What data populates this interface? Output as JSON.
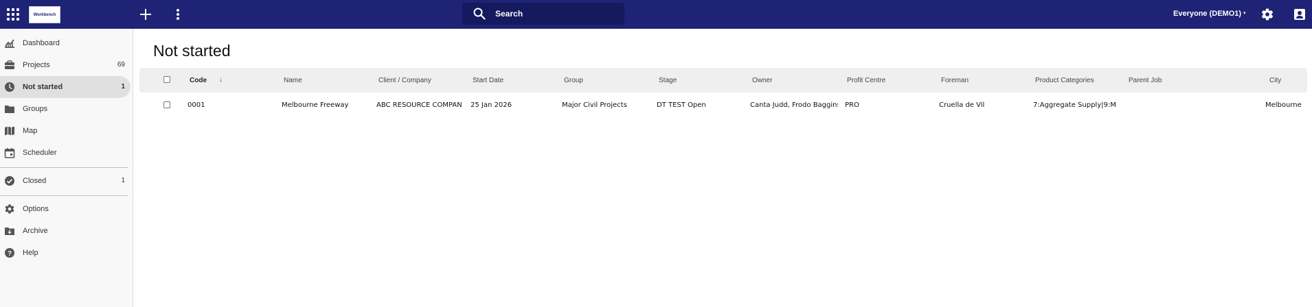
{
  "header": {
    "logo_text": "Workbench",
    "search_label": "Search",
    "workspace_label": "Everyone (DEMO1)",
    "workspace_caret": "▾"
  },
  "sidebar": {
    "items": [
      {
        "label": "Dashboard",
        "count": "",
        "icon": "dashboard-chart-icon"
      },
      {
        "label": "Projects",
        "count": "69",
        "icon": "projects-folder-icon"
      },
      {
        "label": "Not started",
        "count": "1",
        "icon": "clock-icon",
        "active": true
      },
      {
        "label": "Groups",
        "count": "",
        "icon": "folder-icon"
      },
      {
        "label": "Map",
        "count": "",
        "icon": "map-icon"
      },
      {
        "label": "Scheduler",
        "count": "",
        "icon": "calendar-icon"
      },
      {
        "label": "Closed",
        "count": "1",
        "icon": "check-circle-icon"
      },
      {
        "label": "Options",
        "count": "",
        "icon": "gear-icon"
      },
      {
        "label": "Archive",
        "count": "",
        "icon": "archive-icon"
      },
      {
        "label": "Help",
        "count": "",
        "icon": "help-icon"
      }
    ]
  },
  "main": {
    "title": "Not started",
    "sort_indicator": "↓",
    "columns": [
      "Code",
      "Name",
      "Client / Company",
      "Start Date",
      "Group",
      "Stage",
      "Owner",
      "Profit Centre",
      "Foreman",
      "Product Categories",
      "Parent Job",
      "City"
    ],
    "rows": [
      {
        "code": "0001",
        "name": "Melbourne Freeway",
        "client": "ABC RESOURCE COMPANY",
        "start_date": "25 Jan 2026",
        "group": "Major Civil Projects",
        "stage": "DT TEST Open",
        "owner": "Canta Judd, Frodo Baggins",
        "profit_centre": "PRO",
        "foreman": "Cruella de Vil",
        "product_categories": "7:Aggregate Supply|9:M",
        "parent_job": "",
        "city": "Melbourne"
      }
    ]
  },
  "colors": {
    "topbar": "#1e2375",
    "search_bg": "#15195e",
    "sidebar_bg": "#f8f8f8",
    "active_item": "#e0e0e0"
  }
}
